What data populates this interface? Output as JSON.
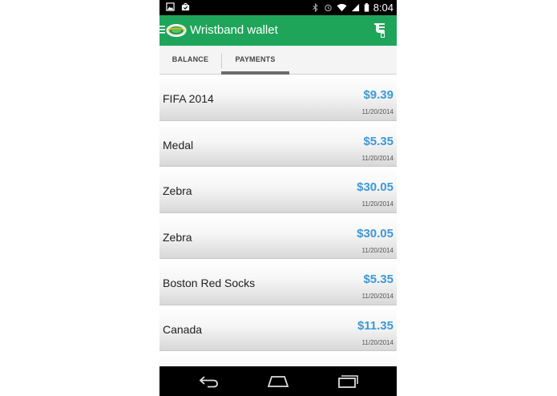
{
  "status_bar": {
    "time": "8:04",
    "left_icons": [
      "image-icon",
      "shopping-bag-icon"
    ],
    "right_icons": [
      "bluetooth-icon",
      "alarm-icon",
      "wifi-icon",
      "signal-icon",
      "battery-icon"
    ]
  },
  "action_bar": {
    "title": "Wristband wallet",
    "menu_icon": "hamburger-menu-icon",
    "logo_icon": "stadium-logo-icon",
    "action_icon": "wristband-icon",
    "color": "#1ea55a"
  },
  "tabs": [
    {
      "label": "BALANCE",
      "selected": false
    },
    {
      "label": "PAYMENTS",
      "selected": true
    }
  ],
  "payments": [
    {
      "name": "FIFA 2014",
      "amount": "$9.39",
      "date": "11/20/2014"
    },
    {
      "name": "Medal",
      "amount": "$5.35",
      "date": "11/20/2014"
    },
    {
      "name": "Zebra",
      "amount": "$30.05",
      "date": "11/20/2014"
    },
    {
      "name": "Zebra",
      "amount": "$30.05",
      "date": "11/20/2014"
    },
    {
      "name": "Boston Red Socks",
      "amount": "$5.35",
      "date": "11/20/2014"
    },
    {
      "name": "Canada",
      "amount": "$11.35",
      "date": "11/20/2014"
    }
  ],
  "nav_bar": {
    "icons": [
      "back-icon",
      "home-icon",
      "recents-icon"
    ]
  },
  "colors": {
    "amount": "#3d98d6",
    "accent": "#1ea55a"
  }
}
